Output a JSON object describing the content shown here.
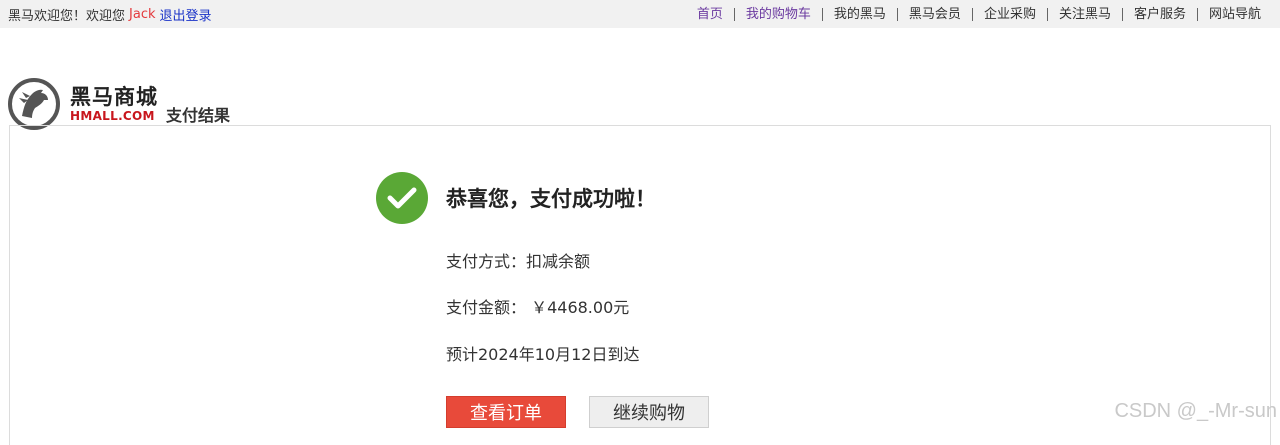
{
  "topbar": {
    "greeting": "黑马欢迎您！欢迎您",
    "username": "Jack",
    "logout": "退出登录",
    "nav": [
      {
        "label": "首页",
        "style": "purple"
      },
      {
        "label": "我的购物车",
        "style": "purple"
      },
      {
        "label": "我的黑马",
        "style": "normal"
      },
      {
        "label": "黑马会员",
        "style": "normal"
      },
      {
        "label": "企业采购",
        "style": "normal"
      },
      {
        "label": "关注黑马",
        "style": "normal"
      },
      {
        "label": "客户服务",
        "style": "normal"
      },
      {
        "label": "网站导航",
        "style": "normal"
      }
    ]
  },
  "header": {
    "brand_name": "黑马商城",
    "brand_domain": "HMALL.COM",
    "page_title": "支付结果"
  },
  "result": {
    "title": "恭喜您，支付成功啦！",
    "method_line": "支付方式：扣减余额",
    "amount_line": "支付金额： ￥4468.00元",
    "delivery_line": "预计2024年10月12日到达",
    "view_order_label": "查看订单",
    "continue_label": "继续购物"
  },
  "watermark": "CSDN @_-Mr-sun",
  "colors": {
    "accent_red": "#e84a3a",
    "success_green": "#5aa836",
    "link_blue": "#1a33c8",
    "link_purple": "#6b3aa0"
  }
}
